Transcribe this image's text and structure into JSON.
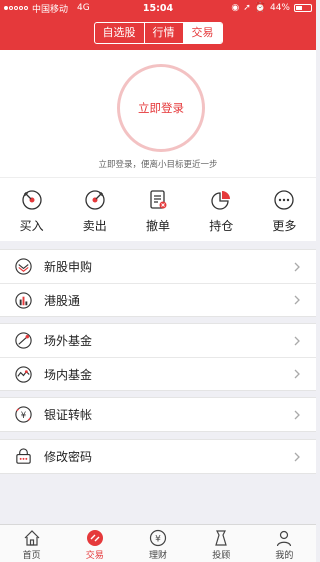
{
  "status_bar": {
    "carrier": "中国移动",
    "network": "4G",
    "time": "15:04",
    "battery": "44%"
  },
  "nav": {
    "tabs": [
      {
        "label": "自选股"
      },
      {
        "label": "行情"
      },
      {
        "label": "交易"
      }
    ],
    "active_tab": "交易"
  },
  "hero": {
    "login_label": "立即登录",
    "tip": "立即登录，便离小目标更近一步"
  },
  "actions": [
    {
      "label": "买入",
      "icon": "buy-icon"
    },
    {
      "label": "卖出",
      "icon": "sell-icon"
    },
    {
      "label": "撤单",
      "icon": "cancel-order-icon"
    },
    {
      "label": "持仓",
      "icon": "holdings-icon"
    },
    {
      "label": "更多",
      "icon": "more-icon"
    }
  ],
  "menu": {
    "group1": [
      {
        "label": "新股申购",
        "icon": "ipo-icon"
      },
      {
        "label": "港股通",
        "icon": "hk-stock-icon"
      }
    ],
    "group2": [
      {
        "label": "场外基金",
        "icon": "otc-fund-icon"
      },
      {
        "label": "场内基金",
        "icon": "exchange-fund-icon"
      }
    ],
    "group3": [
      {
        "label": "银证转帐",
        "icon": "bank-transfer-icon"
      }
    ],
    "group4": [
      {
        "label": "修改密码",
        "icon": "password-icon"
      }
    ]
  },
  "tabbar": {
    "items": [
      {
        "label": "首页",
        "icon": "home-icon"
      },
      {
        "label": "交易",
        "icon": "trade-icon"
      },
      {
        "label": "理财",
        "icon": "finance-icon"
      },
      {
        "label": "投顾",
        "icon": "advisor-icon"
      },
      {
        "label": "我的",
        "icon": "profile-icon"
      }
    ],
    "active": "交易"
  },
  "colors": {
    "brand": "#e5393b",
    "background": "#efeff4"
  }
}
